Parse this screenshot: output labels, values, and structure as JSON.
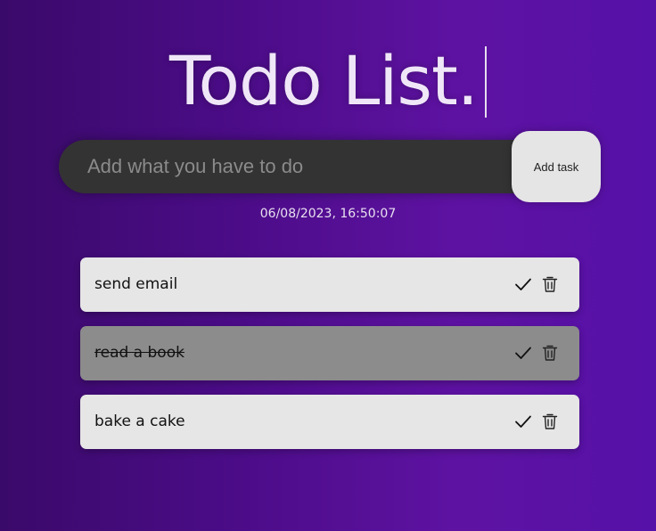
{
  "header": {
    "title": "Todo List."
  },
  "form": {
    "placeholder": "Add what you have to do",
    "value": "",
    "add_label": "Add task"
  },
  "datetime": "06/08/2023, 16:50:07",
  "todos": [
    {
      "text": "send email",
      "completed": false
    },
    {
      "text": "read a book",
      "completed": true
    },
    {
      "text": "bake a cake",
      "completed": false
    }
  ],
  "icons": {
    "complete": "check-icon",
    "delete": "trash-icon"
  },
  "colors": {
    "gradient_start": "#3a0a6a",
    "gradient_end": "#5611a8",
    "input_bg": "#333333",
    "item_bg": "#e6e6e6",
    "item_done_bg": "#8c8c8c"
  }
}
